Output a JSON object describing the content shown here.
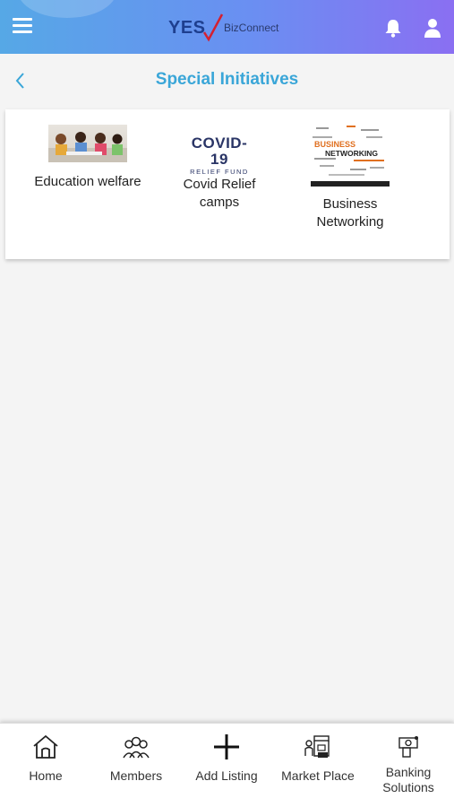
{
  "header": {
    "logo": {
      "brand": "YES",
      "sub": "BizConnect"
    },
    "icons": {
      "menu": "hamburger-menu-icon",
      "notifications": "bell-icon",
      "profile": "user-icon"
    },
    "colors": {
      "gradient_start": "#56a8e6",
      "gradient_end": "#8a6ff2"
    }
  },
  "page": {
    "back_icon": "chevron-left-icon",
    "title": "Special Initiatives",
    "title_color": "#3aa6d8"
  },
  "initiatives": [
    {
      "label": "Education welfare",
      "image": "children-classroom-photo"
    },
    {
      "label_line1": "Covid Relief",
      "label_line2": "camps",
      "image_text": "COVID-19",
      "image_subtext": "RELIEF FUND"
    },
    {
      "label_line1": "Business",
      "label_line2": "Networking",
      "image_text_1": "BUSINESS",
      "image_text_2": "NETWORKING"
    }
  ],
  "bottom_nav": [
    {
      "label": "Home",
      "icon": "home-icon"
    },
    {
      "label": "Members",
      "icon": "members-icon"
    },
    {
      "label": "Add Listing",
      "icon": "plus-icon"
    },
    {
      "label": "Market Place",
      "icon": "market-place-icon"
    },
    {
      "label_line1": "Banking",
      "label_line2": "Solutions",
      "icon": "banking-icon"
    }
  ]
}
